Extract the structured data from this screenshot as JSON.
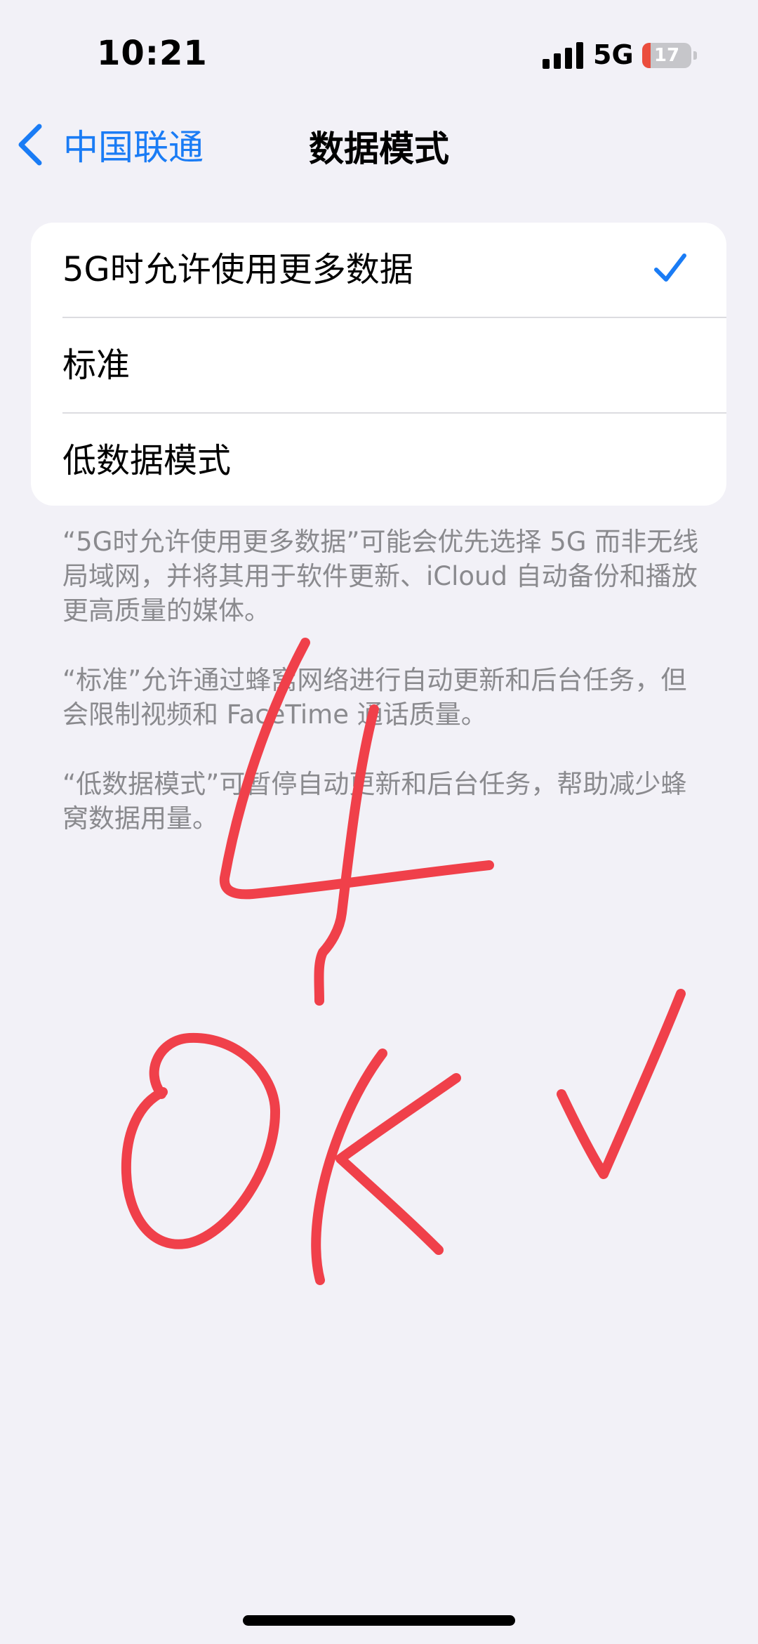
{
  "status_bar": {
    "time": "10:21",
    "network": "5G",
    "battery_level": "17",
    "battery_fraction": 0.17,
    "battery_color": "#eb4d3d"
  },
  "nav": {
    "back_label": "中国联通",
    "title": "数据模式",
    "accent_color": "#1a7cf5"
  },
  "options": [
    {
      "label": "5G时允许使用更多数据",
      "selected": true
    },
    {
      "label": "标准",
      "selected": false
    },
    {
      "label": "低数据模式",
      "selected": false
    }
  ],
  "descriptions": [
    "“5G时允许使用更多数据”可能会优先选择 5G 而非无线局域网，并将其用于软件更新、iCloud 自动备份和播放更高质量的媒体。",
    "“标准”允许通过蜂窝网络进行自动更新和后台任务，但会限制视频和 FaceTime 通话质量。",
    "“低数据模式”可暂停自动更新和后台任务，帮助减少蜂窝数据用量。"
  ],
  "handwriting": {
    "color": "#f0404a",
    "content": "4 OK ✓"
  }
}
